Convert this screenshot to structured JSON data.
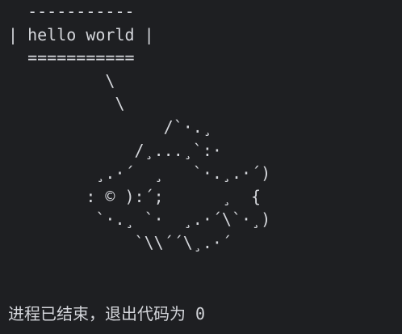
{
  "terminal": {
    "output_lines": [
      "  -----------",
      "| hello world |",
      "  ===========",
      "          \\",
      "           \\",
      "                /`·.¸",
      "             /¸...¸`:·",
      "         ¸.·´  ¸   `·.¸.·´)",
      "        : © ):´;      ¸  {",
      "         `·.¸ `·  ¸.·´\\`·¸)",
      "             `\\\\´´\\¸.·´"
    ],
    "exit_message": "进程已结束，退出代码为 0"
  }
}
